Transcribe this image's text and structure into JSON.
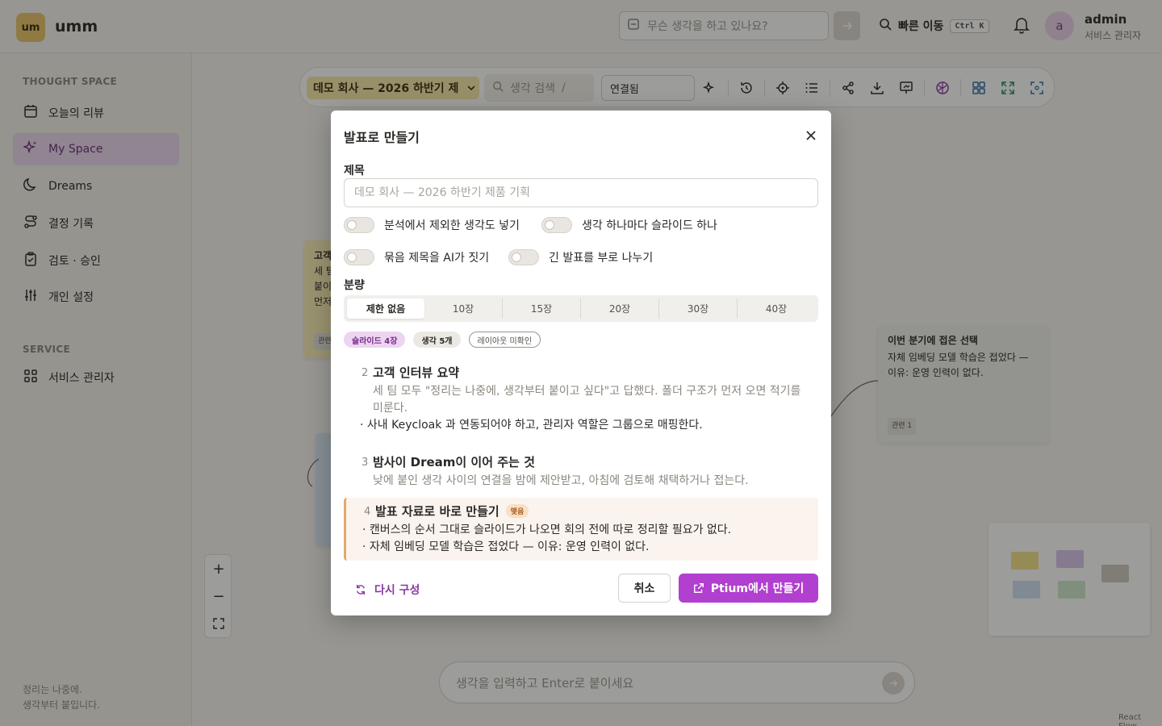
{
  "app": {
    "logo_badge": "um",
    "name": "umm"
  },
  "topbar": {
    "search_placeholder": "무슨 생각을 하고 있나요?",
    "quick_go_label": "빠른 이동",
    "quick_go_shortcut": "Ctrl K",
    "user": {
      "avatar_letter": "a",
      "name": "admin",
      "role": "서비스 관리자"
    }
  },
  "sidebar": {
    "section_thought": "THOUGHT SPACE",
    "items": [
      {
        "label": "오늘의 리뷰",
        "icon": "calendar-icon"
      },
      {
        "label": "My Space",
        "icon": "sparkle-icon",
        "active": true
      },
      {
        "label": "Dreams",
        "icon": "moon-icon"
      },
      {
        "label": "결정 기록",
        "icon": "route-icon"
      },
      {
        "label": "검토 · 승인",
        "icon": "clipboard-check-icon"
      },
      {
        "label": "개인 설정",
        "icon": "sliders-icon"
      }
    ],
    "section_service": "SERVICE",
    "service_items": [
      {
        "label": "서비스 관리자",
        "icon": "grid-icon"
      }
    ],
    "footer_line1": "정리는 나중에.",
    "footer_line2": "생각부터 붙입니다."
  },
  "toolbar": {
    "space_name": "데모 회사 — 2026 하반기 제",
    "search_placeholder": "생각 검색",
    "search_shortcut": "/",
    "view_select": "연결됨"
  },
  "canvas": {
    "note_right": {
      "title": "이번 분기에 접은 선택",
      "body": "자체 임베딩 모델 학습은 접었다 — 이유: 운영 인력이 없다.",
      "tag": "관련 1"
    },
    "note_left_snippet": [
      "고객",
      "세 팀",
      "붙이",
      "먼저"
    ],
    "note_left_tag": "관련",
    "bottom_input_placeholder": "생각을 입력하고 Enter로 붙이세요",
    "attribution": "React Flow"
  },
  "modal": {
    "title": "발표로 만들기",
    "title_field_label": "제목",
    "title_field_placeholder": "데모 회사 — 2026 하반기 제품 기획",
    "toggles": [
      "분석에서 제외한 생각도 넣기",
      "생각 하나마다 슬라이드 하나",
      "묶음 제목을 AI가 짓기",
      "긴 발표를 부로 나누기"
    ],
    "amount_label": "분량",
    "amount_options": [
      "제한 없음",
      "10장",
      "15장",
      "20장",
      "30장",
      "40장"
    ],
    "amount_selected": "제한 없음",
    "chips": {
      "slides": "슬라이드 4장",
      "thoughts": "생각 5개",
      "layout": "레이아웃 미확인"
    },
    "slides": [
      {
        "num": "2",
        "title": "고객 인터뷰 요약",
        "body": "세 팀 모두 \"정리는 나중에, 생각부터 붙이고 싶다\"고 답했다. 폴더 구조가 먼저 오면 적기를 미룬다.",
        "bullets": [
          "사내 Keycloak 과 연동되어야 하고, 관리자 역할은 그룹으로 매핑한다."
        ]
      },
      {
        "num": "3",
        "title": "밤사이 Dream이 이어 주는 것",
        "body": "낮에 붙인 생각 사이의 연결을 밤에 제안받고, 아침에 검토해 채택하거나 접는다.",
        "bullets": []
      },
      {
        "num": "4",
        "title": "발표 자료로 바로 만들기",
        "badge": "맺음",
        "bullets": [
          "캔버스의 순서 그대로 슬라이드가 나오면 회의 전에 따로 정리할 필요가 없다.",
          "자체 임베딩 모델 학습은 접었다 — 이유: 운영 인력이 없다."
        ]
      }
    ],
    "regenerate_label": "다시 구성",
    "cancel_label": "취소",
    "primary_label": "Ptium에서 만들기"
  },
  "colors": {
    "accent": "#b13fcf",
    "brand_badge": "#e9c46a",
    "active_nav": "#ead7ef"
  }
}
